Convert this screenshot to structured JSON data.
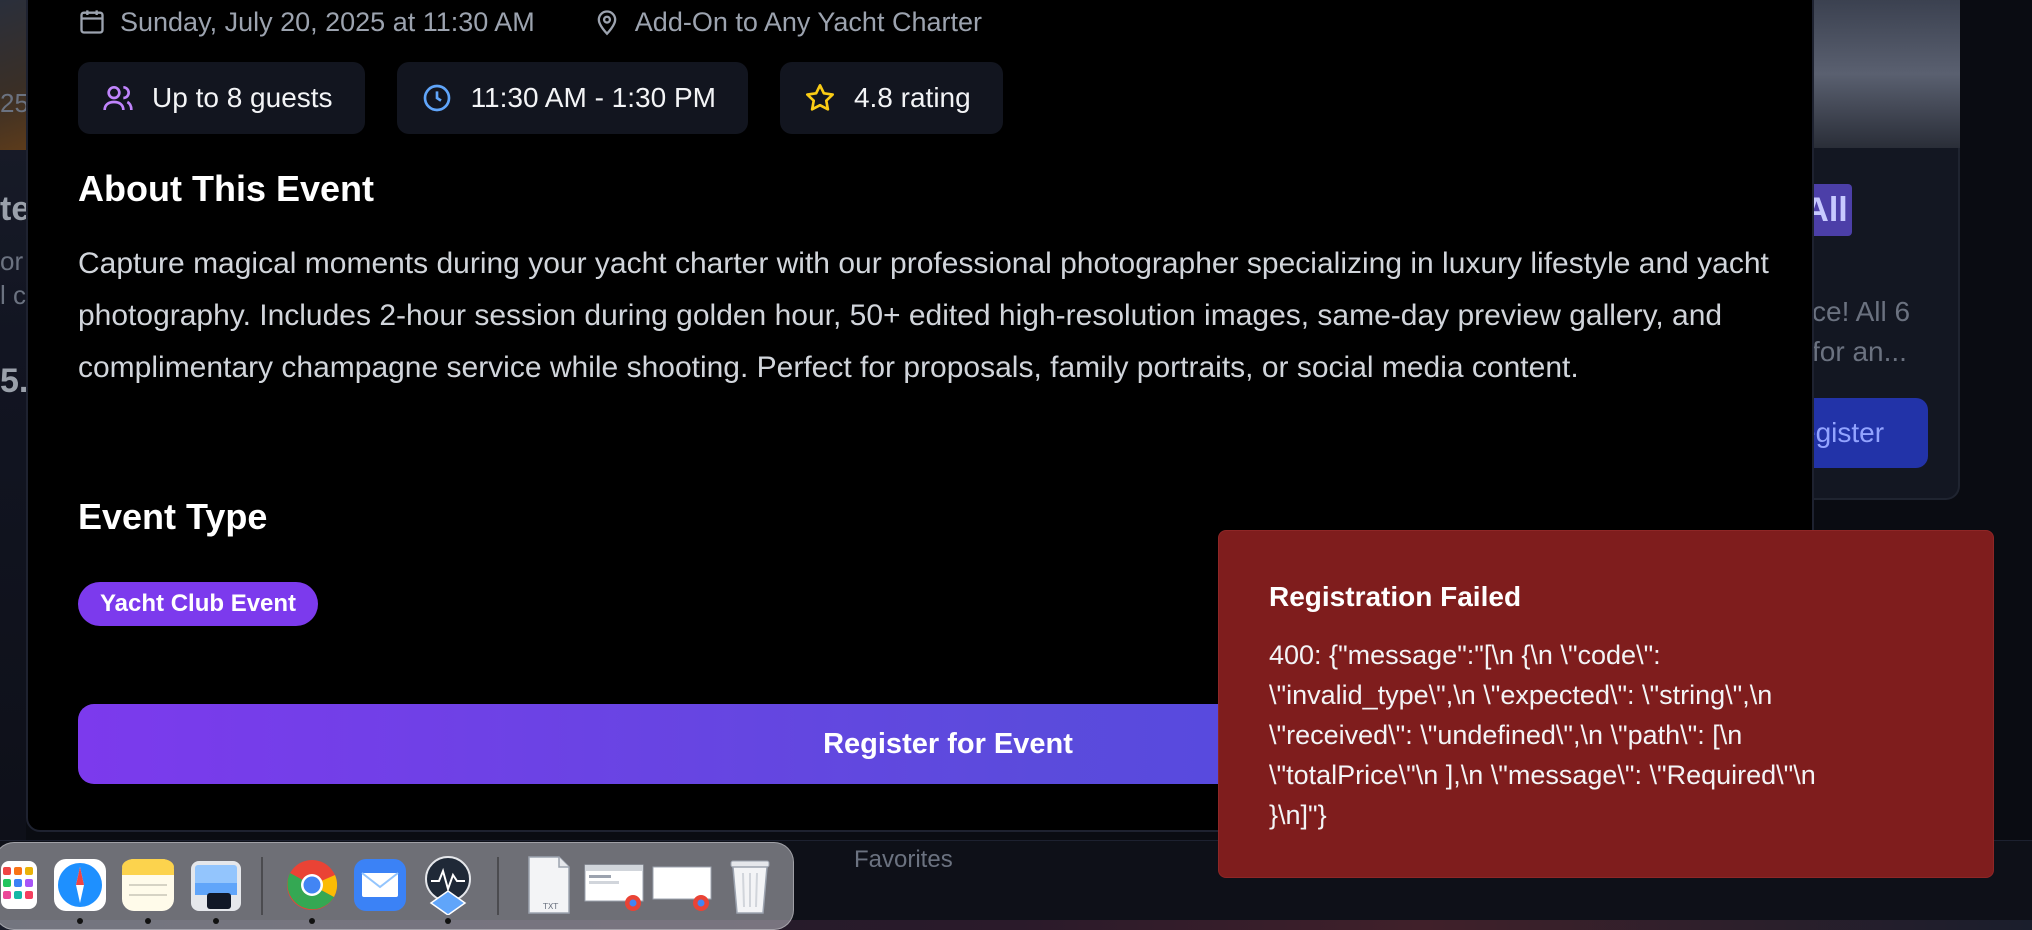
{
  "event": {
    "date": "Sunday, July 20, 2025 at 11:30 AM",
    "location": "Add-On to Any Yacht Charter",
    "chips": {
      "guests": "Up to 8 guests",
      "time": "11:30 AM - 1:30 PM",
      "rating": "4.8 rating"
    },
    "about_heading": "About This Event",
    "about_text": "Capture magical moments during your yacht charter with our professional photographer specializing in luxury lifestyle and yacht photography. Includes 2-hour session during golden hour, 50+ edited high-resolution images, same-day preview gallery, and complimentary champagne service while shooting. Perfect for proposals, family portraits, or social media content.",
    "type_heading": "Event Type",
    "type_label": "Yacht Club Event",
    "register_label": "Register for Event"
  },
  "toast": {
    "title": "Registration Failed",
    "message": "400: {\"message\":\"[\\n {\\n \\\"code\\\":\n\\\"invalid_type\\\",\\n \\\"expected\\\": \\\"string\\\",\\n\n\\\"received\\\": \\\"undefined\\\",\\n \\\"path\\\": [\\n\n\\\"totalPrice\\\"\\n ],\\n \\\"message\\\": \\\"Required\\\"\\n\n}\\n]\"}"
  },
  "background": {
    "left_fragments": [
      "25",
      "te",
      "or",
      "l c",
      "5."
    ],
    "right_badge": "All",
    "right_text_1": "ce! All 6",
    "right_text_2": "for an...",
    "right_button": "egister",
    "bottom_nav": "Favorites"
  },
  "dock": {
    "apps": [
      "launchpad",
      "safari",
      "notes",
      "preview",
      "chrome",
      "mail",
      "instruments",
      "text-file",
      "chrome-window-1",
      "chrome-window-2",
      "trash"
    ]
  },
  "colors": {
    "accent": "#7c3aed",
    "accent_end": "#4f46e5",
    "toast_bg": "#7f1d1d",
    "chip_bg": "#12151f"
  }
}
